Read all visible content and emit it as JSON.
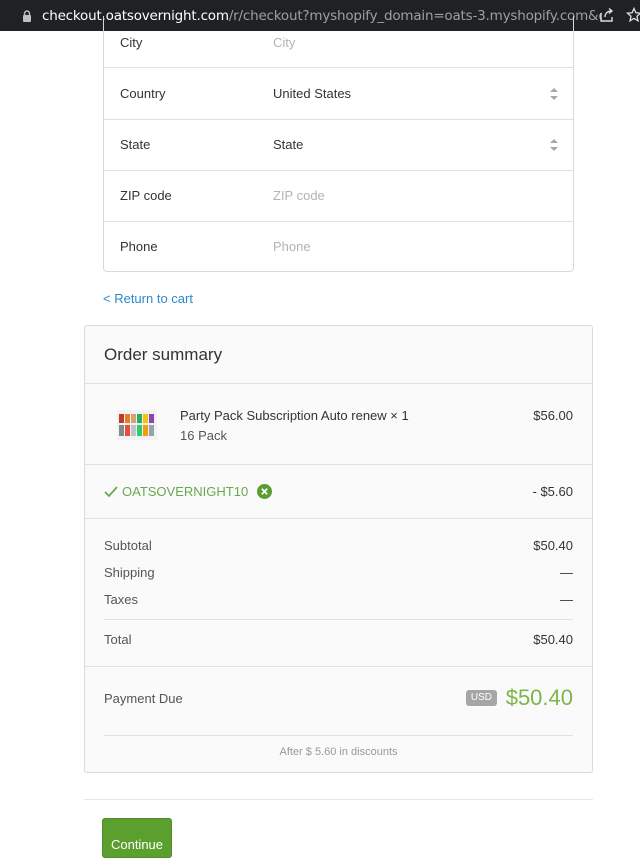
{
  "browser": {
    "url_domain": "checkout.oatsovernight.com",
    "url_path": "/r/checkout?myshopify_domain=oats-3.myshopify.com&cart_token...",
    "lock_icon": "lock-icon",
    "share_icon": "share-icon",
    "bookmark_icon": "star-icon"
  },
  "address_form": {
    "city": {
      "label": "City",
      "placeholder": "City"
    },
    "country": {
      "label": "Country",
      "value": "United States"
    },
    "state": {
      "label": "State",
      "value": "State"
    },
    "zip": {
      "label": "ZIP code",
      "placeholder": "ZIP code"
    },
    "phone": {
      "label": "Phone",
      "placeholder": "Phone"
    }
  },
  "return_link": "< Return to cart",
  "summary": {
    "title": "Order summary",
    "item": {
      "name": "Party Pack Subscription Auto renew × 1",
      "variant": "16 Pack",
      "price": "$56.00"
    },
    "discount": {
      "code": "OATSOVERNIGHT10",
      "amount": "- $5.60"
    },
    "subtotal": {
      "label": "Subtotal",
      "value": "$50.40"
    },
    "shipping": {
      "label": "Shipping",
      "value": "—"
    },
    "taxes": {
      "label": "Taxes",
      "value": "—"
    },
    "total": {
      "label": "Total",
      "value": "$50.40"
    },
    "payment_due": {
      "label": "Payment Due",
      "currency": "USD",
      "value": "$50.40"
    },
    "after_discounts": "After $ 5.60 in discounts"
  },
  "continue_button": "Continue",
  "colors": {
    "accent_green": "#7ab648",
    "button_green": "#5ba02f",
    "link_blue": "#2a8bc7"
  }
}
